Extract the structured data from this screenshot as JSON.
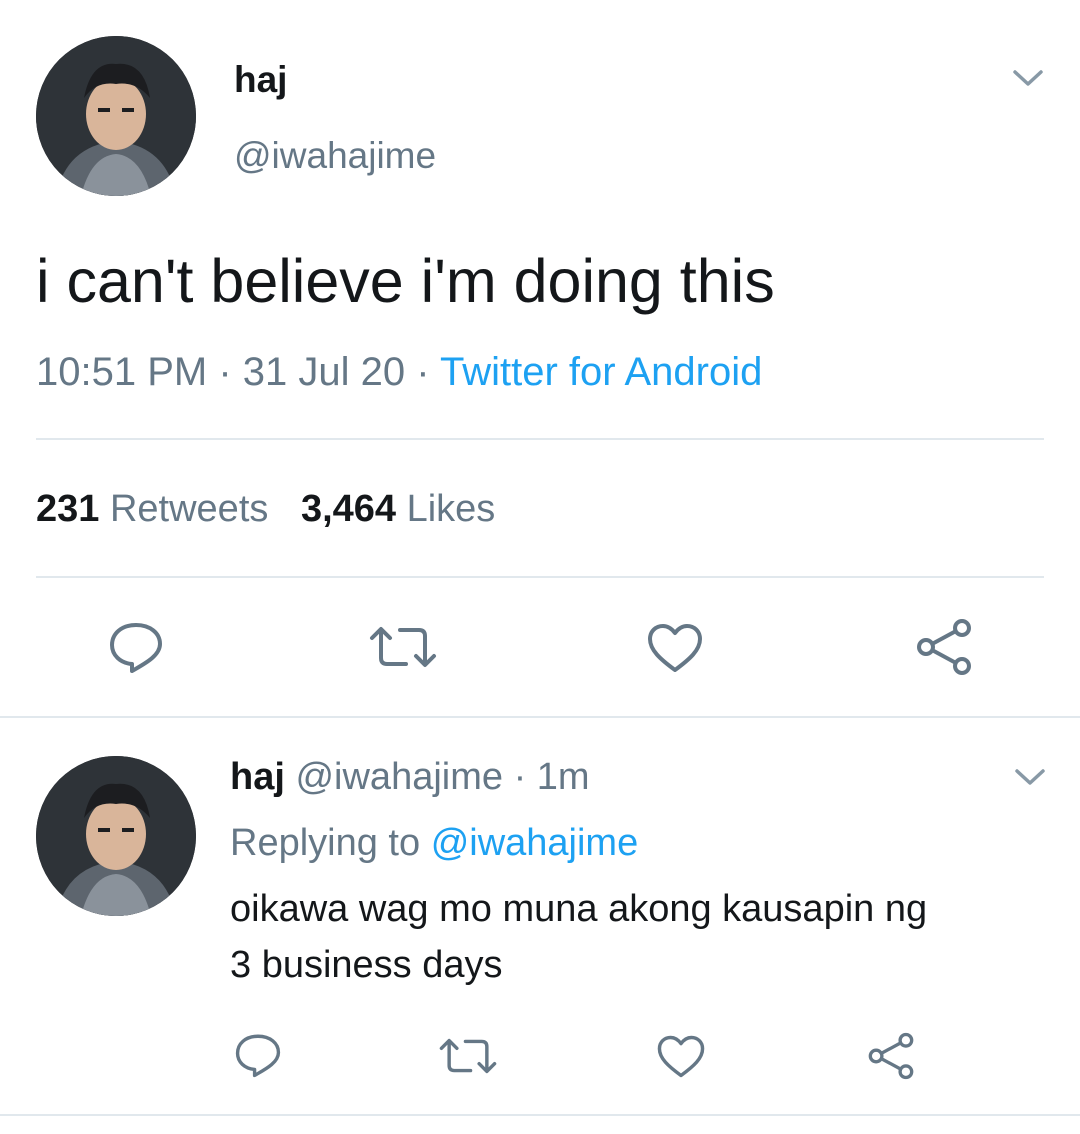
{
  "main_tweet": {
    "display_name": "haj",
    "handle": "@iwahajime",
    "text": "i can't believe i'm doing this",
    "time": "10:51 PM",
    "separator": "·",
    "date": "31 Jul 20",
    "source": "Twitter for Android",
    "retweet_count": "231",
    "retweet_label": "Retweets",
    "like_count": "3,464",
    "like_label": "Likes",
    "actions": [
      "reply-icon",
      "retweet-icon",
      "like-icon",
      "share-icon"
    ]
  },
  "reply_tweet": {
    "display_name": "haj",
    "handle": "@iwahajime",
    "separator": "·",
    "age": "1m",
    "replying_label": "Replying to",
    "replying_to": "@iwahajime",
    "text_line1": "oikawa wag mo muna akong kausapin ng",
    "text_line2": "3 business days",
    "actions": [
      "reply-icon",
      "retweet-icon",
      "like-icon",
      "share-icon"
    ]
  },
  "colors": {
    "text": "#14171a",
    "muted": "#657786",
    "link": "#1da1f2",
    "divider": "#e1e8ed"
  }
}
